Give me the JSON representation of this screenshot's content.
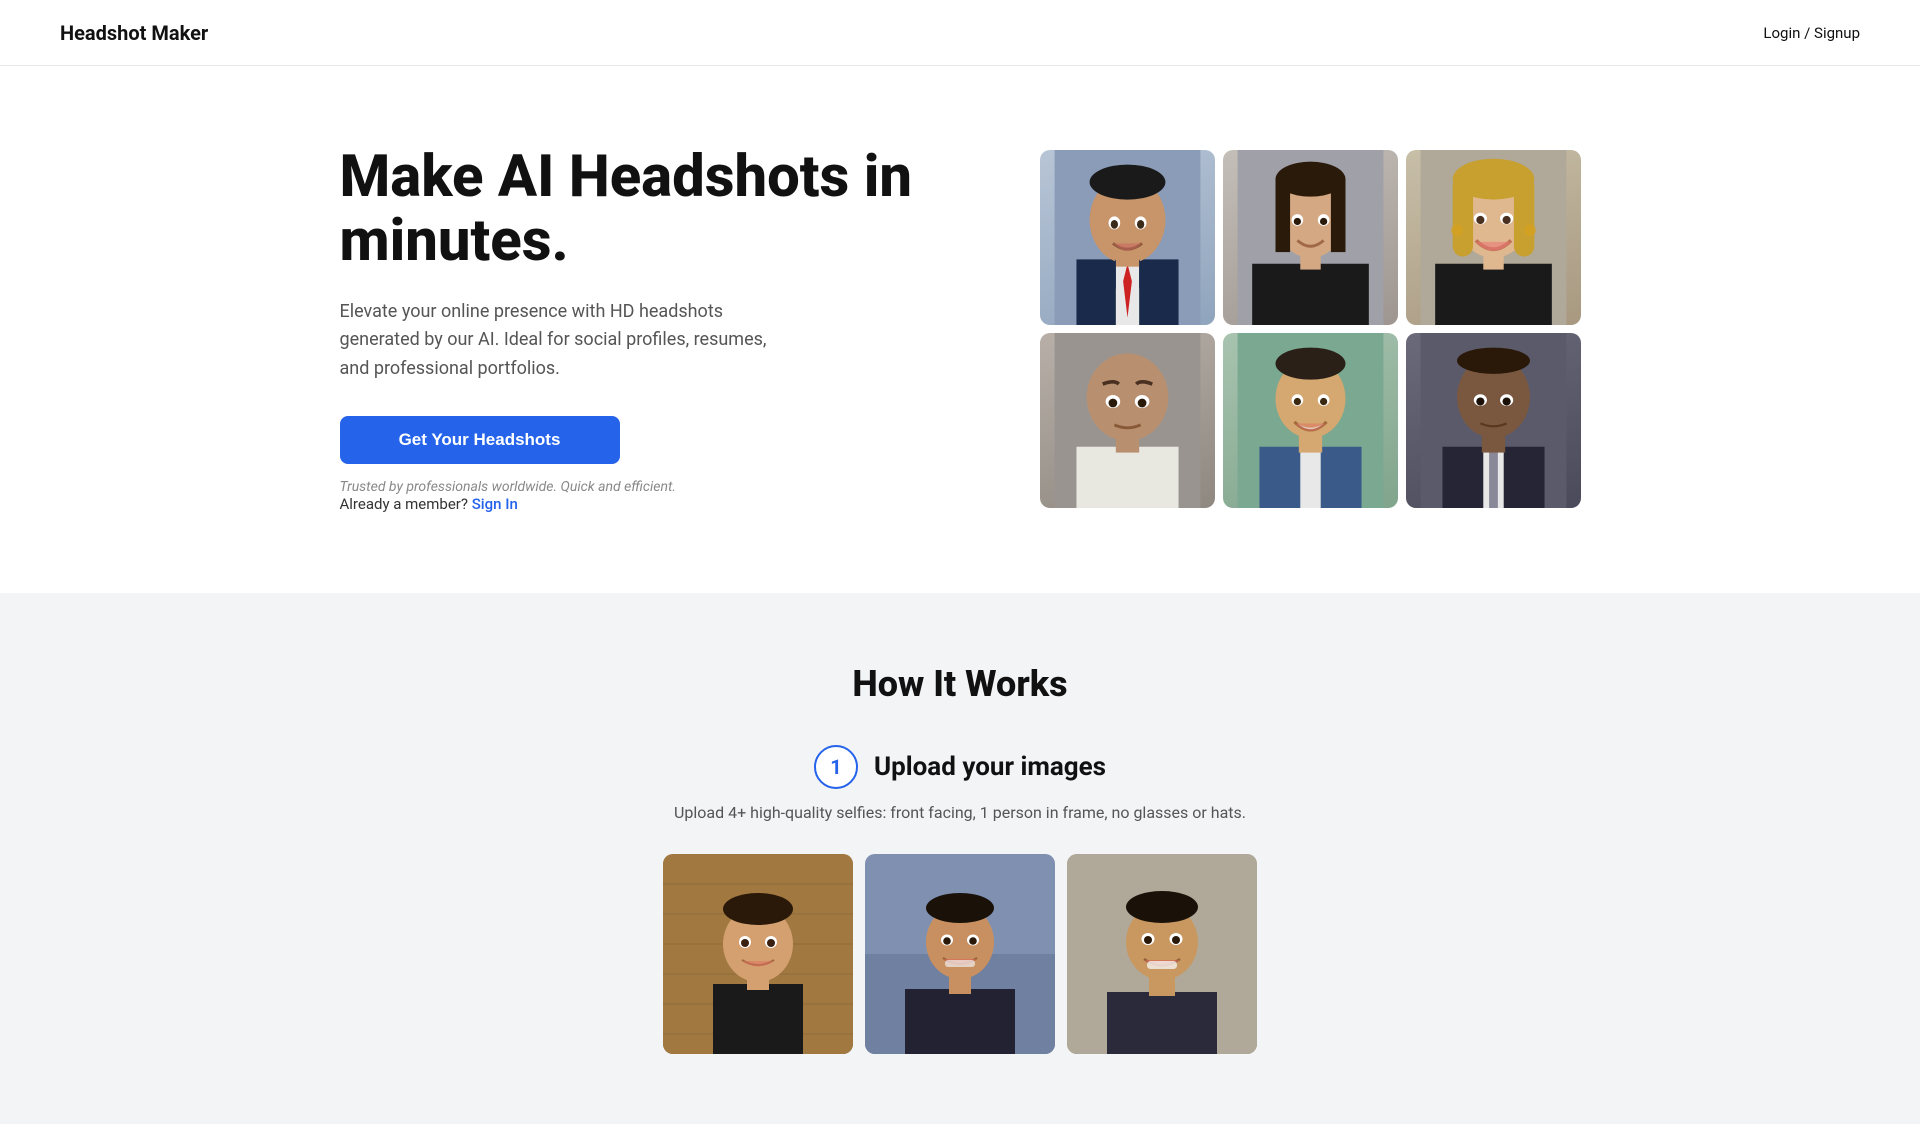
{
  "nav": {
    "logo": "Headshot Maker",
    "login_label": "Login / Signup"
  },
  "hero": {
    "title": "Make AI Headshots in minutes.",
    "subtitle": "Elevate your online presence with HD headshots generated by our AI. Ideal for social profiles, resumes, and professional portfolios.",
    "cta_button": "Get Your Headshots",
    "trusted_text": "Trusted by professionals worldwide. Quick and efficient.",
    "member_prefix": "Already a member?",
    "sign_in_label": "Sign In"
  },
  "how_it_works": {
    "title": "How It Works",
    "step1": {
      "number": "1",
      "label": "Upload your images",
      "description": "Upload 4+ high-quality selfies: front facing, 1 person in frame, no glasses or hats."
    }
  },
  "headshots": [
    {
      "id": "person-1",
      "alt": "Man in suit with red tie"
    },
    {
      "id": "person-2",
      "alt": "Woman with dark hair in black outfit"
    },
    {
      "id": "person-3",
      "alt": "Blonde woman smiling"
    },
    {
      "id": "person-4",
      "alt": "Bald man with serious expression"
    },
    {
      "id": "person-5",
      "alt": "Young man in blue suit with green background"
    },
    {
      "id": "person-6",
      "alt": "Black man in dark suit"
    }
  ],
  "upload_photos": [
    {
      "id": "upload-1",
      "alt": "Selfie in front of wooden wall"
    },
    {
      "id": "upload-2",
      "alt": "Man smiling outdoors"
    },
    {
      "id": "upload-3",
      "alt": "Man smiling close up"
    }
  ]
}
